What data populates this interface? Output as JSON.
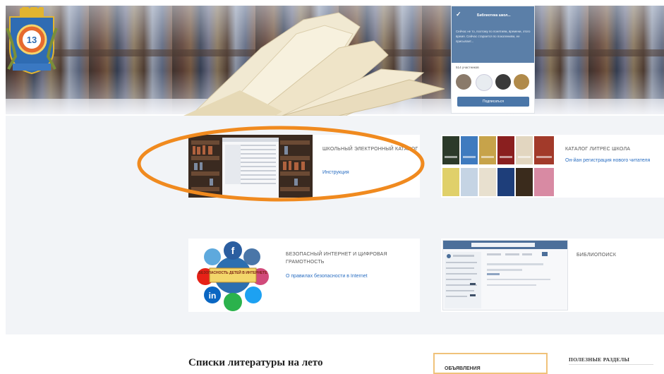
{
  "header": {
    "crest_number": "13",
    "vk_widget": {
      "group_name": "Библиотека школ...",
      "description": "Сейчас не то, поэтому по понятиям, времени, этого время. Сейчас старается по поколениям, ее присылает...",
      "members_text": "514 участников",
      "subscribe_label": "Подписаться"
    }
  },
  "cards": [
    {
      "title": "ШКОЛЬНЫЙ ЭЛЕКТРОННЫЙ КАТАЛОГ",
      "link": "Инструкция"
    },
    {
      "title": "КАТАЛОГ ЛИТРЕС ШКОЛА",
      "link": "Он-йан регистрация нового читателя"
    },
    {
      "title": "БЕЗОПАСНЫЙ ИНТЕРНЕТ И ЦИФРОВАЯ ГРАМОТНОСТЬ",
      "link": "О правилах безопасности в Internet",
      "image_banner": "БЕЗОПАСНОСТЬ ДЕТЕЙ В ИНТЕРНЕТЕ"
    },
    {
      "title": "БИБЛИОПОИСК"
    }
  ],
  "bottom": {
    "section_title": "Списки литературы на лето",
    "notice_label": "ОБЪЯВЛЕНИЯ",
    "useful_label": "ПОЛЕЗНЫЕ РАЗДЕЛЫ"
  },
  "colors": {
    "link": "#2b6fc2",
    "highlight_ellipse": "#f08a1f",
    "vk_blue": "#4a76a8",
    "content_bg": "#f2f4f7"
  }
}
